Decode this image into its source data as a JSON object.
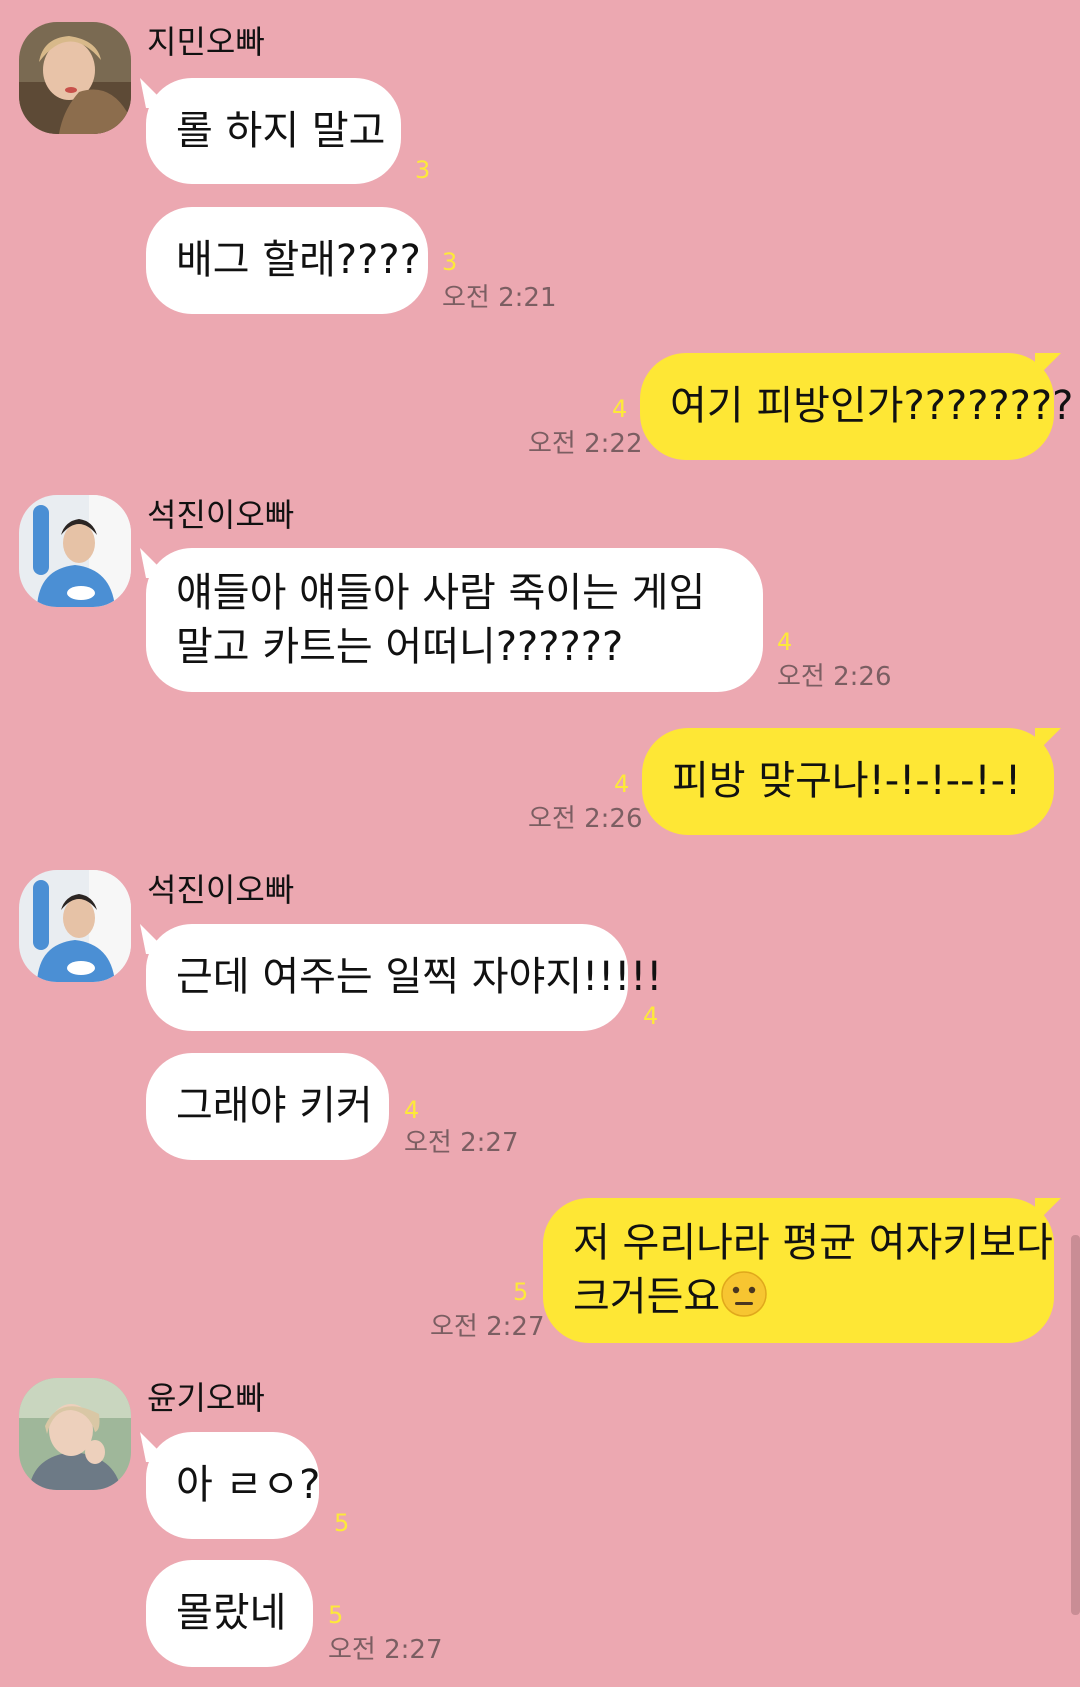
{
  "messages": [
    {
      "sender": "지민오빠",
      "text": "롤 하지 말고",
      "count": "3"
    },
    {
      "text": "배그 할래????",
      "count": "3",
      "time": "오전 2:21"
    },
    {
      "text": "여기 피방인가????????",
      "count": "4",
      "time": "오전 2:22"
    },
    {
      "sender": "석진이오빠",
      "line1": "얘들아 얘들아 사람 죽이는 게임",
      "line2": "말고 카트는 어떠니??????",
      "count": "4",
      "time": "오전 2:26"
    },
    {
      "text": "피방 맞구나!-!-!--!-!",
      "count": "4",
      "time": "오전 2:26"
    },
    {
      "sender": "석진이오빠",
      "text": "근데 여주는 일찍 자야지!!!!!",
      "count": "4"
    },
    {
      "text": "그래야 키커",
      "count": "4",
      "time": "오전 2:27"
    },
    {
      "line1": "저 우리나라 평균 여자키보다",
      "line2": "크거든요",
      "count": "5",
      "time": "오전 2:27"
    },
    {
      "sender": "윤기오빠",
      "text": "아 ㄹㅇ?",
      "count": "5"
    },
    {
      "text": "몰랐네",
      "count": "5",
      "time": "오전 2:27"
    }
  ],
  "icons": {
    "neutral_face": "neutral-face-emoji",
    "avatar_1": "jimin-avatar",
    "avatar_2": "seokjin-avatar",
    "avatar_3": "yoongi-avatar"
  },
  "colors": {
    "background": "#eca8b1",
    "incoming_bubble": "#ffffff",
    "outgoing_bubble": "#fee735",
    "unread_count": "#fde93a",
    "timestamp": "#7b5e62"
  }
}
